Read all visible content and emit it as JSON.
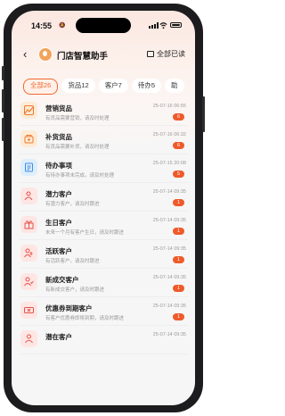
{
  "status": {
    "time": "14:55"
  },
  "header": {
    "title": "门店智慧助手",
    "read_all": "全部已读"
  },
  "tabs": [
    {
      "label": "全部26",
      "active": true
    },
    {
      "label": "货品12",
      "active": false
    },
    {
      "label": "客户7",
      "active": false
    },
    {
      "label": "待办5",
      "active": false
    },
    {
      "label": "助",
      "active": false
    }
  ],
  "items": [
    {
      "name": "营销货品",
      "desc": "有货品需要营销，请及时处理",
      "time": "25-07-16 06:55",
      "badge": "6",
      "icon": "chart-icon",
      "color": "#fdebd6"
    },
    {
      "name": "补货货品",
      "desc": "有货品需要补货，请及时处理",
      "time": "25-07-16 06:32",
      "badge": "6",
      "icon": "box-icon",
      "color": "#fdebd6"
    },
    {
      "name": "待办事项",
      "desc": "有待办事项未完成，请及时处理",
      "time": "25-07-15 20:08",
      "badge": "5",
      "icon": "task-icon",
      "color": "#dfeefb"
    },
    {
      "name": "潜力客户",
      "desc": "有潜力客户，请及时跟进",
      "time": "25-07-14 09:35",
      "badge": "1",
      "icon": "person-up-icon",
      "color": "#fde6e4"
    },
    {
      "name": "生日客户",
      "desc": "未来一个月有客户生日，请及时跟进",
      "time": "25-07-14 09:35",
      "badge": "1",
      "icon": "gift-icon",
      "color": "#fde6e4"
    },
    {
      "name": "活跃客户",
      "desc": "有活跃客户，请及时跟进",
      "time": "25-07-14 09:35",
      "badge": "1",
      "icon": "person-active-icon",
      "color": "#fde6e4"
    },
    {
      "name": "新成交客户",
      "desc": "有新成交客户，请及时跟进",
      "time": "25-07-14 09:35",
      "badge": "1",
      "icon": "person-new-icon",
      "color": "#fde6e4"
    },
    {
      "name": "优惠券到期客户",
      "desc": "有客户优惠券即将到期，请及时跟进",
      "time": "25-07-14 09:35",
      "badge": "1",
      "icon": "coupon-icon",
      "color": "#fde6e4"
    },
    {
      "name": "潜在客户",
      "desc": "",
      "time": "25-07-14 09:35",
      "badge": "",
      "icon": "person-icon",
      "color": "#fde6e4"
    }
  ]
}
